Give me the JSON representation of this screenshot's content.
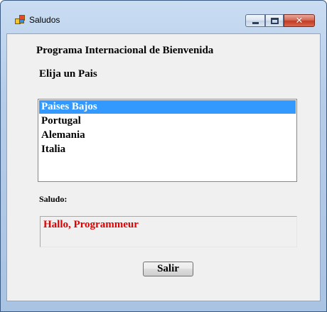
{
  "window": {
    "title": "Saludos",
    "close_glyph": "✕"
  },
  "content": {
    "program_title": "Programa Internacional de Bienvenida",
    "choose_label": "Elija un Pais",
    "countries": [
      "Paises Bajos",
      "Portugal",
      "Alemania",
      "Italia"
    ],
    "selected_index": 0,
    "greeting_label": "Saludo:",
    "greeting_text": "Hallo, Programmeur",
    "exit_button": "Salir"
  },
  "colors": {
    "selection": "#3399ff",
    "greeting_text": "#e00000"
  },
  "icons": {
    "app": "app-icon",
    "minimize": "minimize-icon",
    "maximize": "maximize-icon",
    "close": "close-icon"
  }
}
